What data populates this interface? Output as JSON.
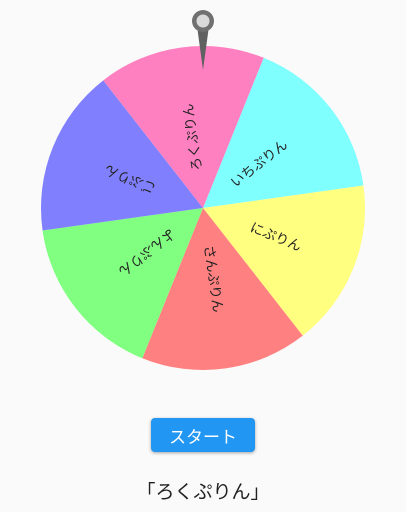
{
  "wheel": {
    "segments": [
      {
        "label": "いちぷりん",
        "color": "#80ffff"
      },
      {
        "label": "にぷりん",
        "color": "#ffff80"
      },
      {
        "label": "さんぷりん",
        "color": "#ff8080"
      },
      {
        "label": "よんぷりん",
        "color": "#80ff80"
      },
      {
        "label": "ごぷりん",
        "color": "#8080ff"
      },
      {
        "label": "ろくぷりん",
        "color": "#ff80c0"
      }
    ],
    "pointer_icon": "map-pin-icon",
    "pointer_color": "#666666"
  },
  "controls": {
    "start_label": "スタート",
    "start_color": "#2196f3"
  },
  "result": {
    "text": "「ろくぷりん」"
  }
}
